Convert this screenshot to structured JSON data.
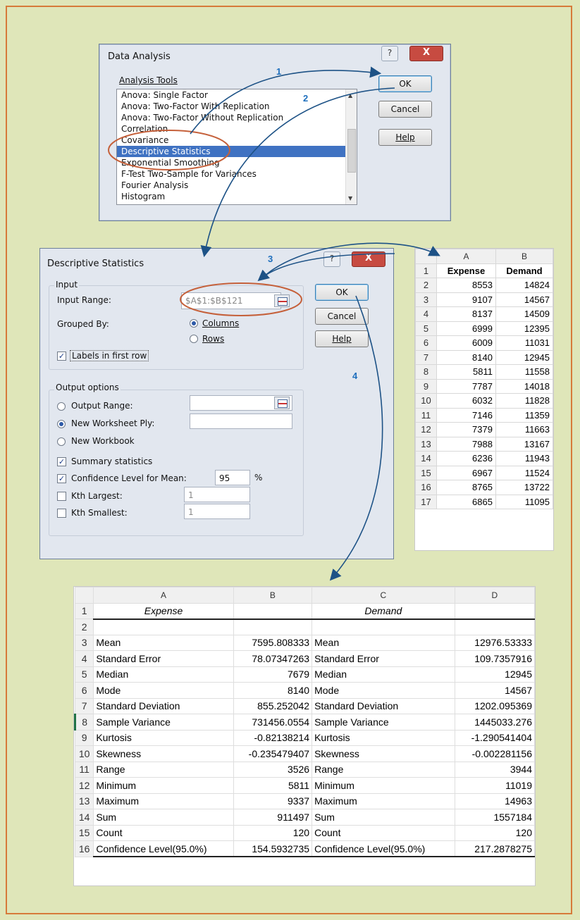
{
  "colors": {
    "background": "#dfe6b9",
    "frame": "#d77a3a",
    "arrow": "#1d5286",
    "callout": "#c5603a",
    "selection": "#3f72c2"
  },
  "steps": [
    "1",
    "2",
    "3",
    "4"
  ],
  "data_analysis": {
    "title": "Data Analysis",
    "help_icon": "?",
    "close_icon": "X",
    "tools_label": "Analysis Tools",
    "tools": [
      "Anova: Single Factor",
      "Anova: Two-Factor With Replication",
      "Anova: Two-Factor Without Replication",
      "Correlation",
      "Covariance",
      "Descriptive Statistics",
      "Exponential Smoothing",
      "F-Test Two-Sample for Variances",
      "Fourier Analysis",
      "Histogram"
    ],
    "selected": "Descriptive Statistics",
    "ok": "OK",
    "cancel": "Cancel",
    "help": "Help"
  },
  "desc_stats": {
    "title": "Descriptive Statistics",
    "help_icon": "?",
    "close_icon": "X",
    "input_group": "Input",
    "input_range_label": "Input Range:",
    "input_range_value": "$A$1:$B$121",
    "grouped_by_label": "Grouped By:",
    "columns": "Columns",
    "rows": "Rows",
    "labels_first_row": "Labels in first row",
    "ok": "OK",
    "cancel": "Cancel",
    "help": "Help",
    "output_group": "Output options",
    "output_range": "Output Range:",
    "new_ply": "New Worksheet Ply:",
    "new_workbook": "New Workbook",
    "summary_stats": "Summary statistics",
    "confidence": "Confidence Level for Mean:",
    "confidence_value": "95",
    "percent": "%",
    "kth_largest": "Kth Largest:",
    "kth_largest_value": "1",
    "kth_smallest": "Kth Smallest:",
    "kth_smallest_value": "1"
  },
  "data_sheet": {
    "col_headers": [
      "A",
      "B"
    ],
    "rows": [
      [
        "1",
        "Expense",
        "Demand"
      ],
      [
        "2",
        "8553",
        "14824"
      ],
      [
        "3",
        "9107",
        "14567"
      ],
      [
        "4",
        "8137",
        "14509"
      ],
      [
        "5",
        "6999",
        "12395"
      ],
      [
        "6",
        "6009",
        "11031"
      ],
      [
        "7",
        "8140",
        "12945"
      ],
      [
        "8",
        "5811",
        "11558"
      ],
      [
        "9",
        "7787",
        "14018"
      ],
      [
        "10",
        "6032",
        "11828"
      ],
      [
        "11",
        "7146",
        "11359"
      ],
      [
        "12",
        "7379",
        "11663"
      ],
      [
        "13",
        "7988",
        "13167"
      ],
      [
        "14",
        "6236",
        "11943"
      ],
      [
        "15",
        "6967",
        "11524"
      ],
      [
        "16",
        "8765",
        "13722"
      ],
      [
        "17",
        "6865",
        "11095"
      ]
    ]
  },
  "output_sheet": {
    "col_headers": [
      "A",
      "B",
      "C",
      "D"
    ],
    "rows": [
      [
        "1",
        "Expense",
        "",
        "Demand",
        ""
      ],
      [
        "2",
        "",
        "",
        "",
        ""
      ],
      [
        "3",
        "Mean",
        "7595.808333",
        "Mean",
        "12976.53333"
      ],
      [
        "4",
        "Standard Error",
        "78.07347263",
        "Standard Error",
        "109.7357916"
      ],
      [
        "5",
        "Median",
        "7679",
        "Median",
        "12945"
      ],
      [
        "6",
        "Mode",
        "8140",
        "Mode",
        "14567"
      ],
      [
        "7",
        "Standard Deviation",
        "855.252042",
        "Standard Deviation",
        "1202.095369"
      ],
      [
        "8",
        "Sample Variance",
        "731456.0554",
        "Sample Variance",
        "1445033.276"
      ],
      [
        "9",
        "Kurtosis",
        "-0.82138214",
        "Kurtosis",
        "-1.290541404"
      ],
      [
        "10",
        "Skewness",
        "-0.235479407",
        "Skewness",
        "-0.002281156"
      ],
      [
        "11",
        "Range",
        "3526",
        "Range",
        "3944"
      ],
      [
        "12",
        "Minimum",
        "5811",
        "Minimum",
        "11019"
      ],
      [
        "13",
        "Maximum",
        "9337",
        "Maximum",
        "14963"
      ],
      [
        "14",
        "Sum",
        "911497",
        "Sum",
        "1557184"
      ],
      [
        "15",
        "Count",
        "120",
        "Count",
        "120"
      ],
      [
        "16",
        "Confidence Level(95.0%)",
        "154.5932735",
        "Confidence Level(95.0%)",
        "217.2878275"
      ]
    ]
  }
}
